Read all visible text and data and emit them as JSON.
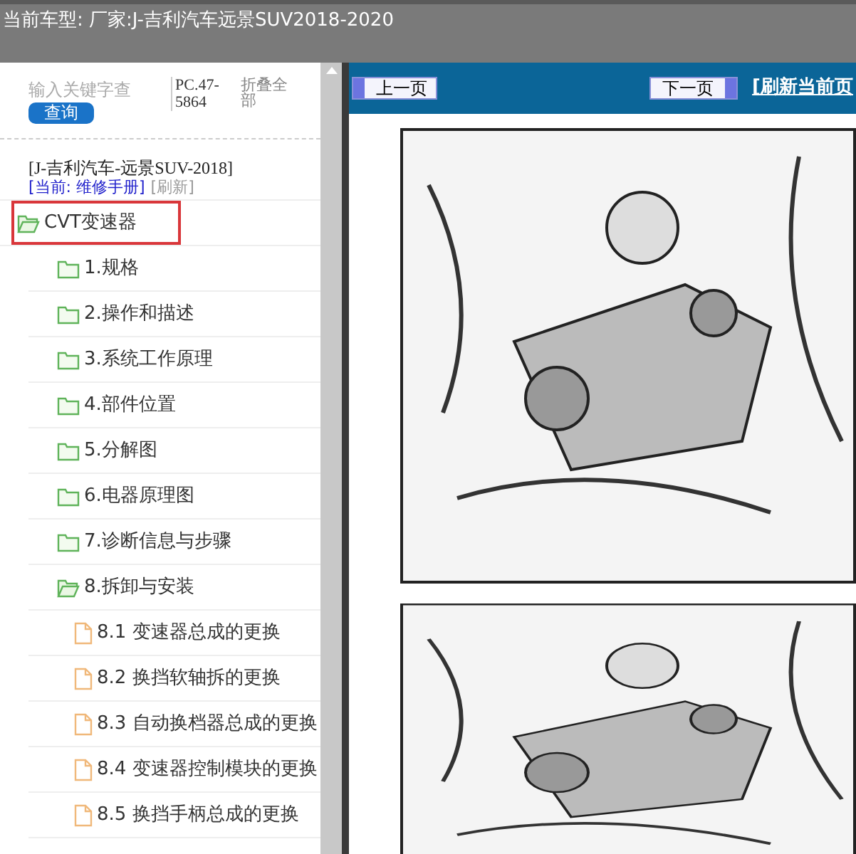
{
  "title_bar": {
    "text": "当前车型:  厂家:J-吉利汽车远景SUV2018-2020"
  },
  "sidebar": {
    "search": {
      "placeholder": "输入关键字查"
    },
    "search_button": "查询",
    "code": "PC.47-5864",
    "collapse_all": "折叠全部",
    "vehicle": "[J-吉利汽车-远景SUV-2018]",
    "current": "[当前: 维修手册]",
    "refresh": "[刷新]",
    "tree": [
      {
        "label": "CVT变速器",
        "kind": "folder",
        "expanded": true,
        "selected": true,
        "children": [
          {
            "label": "1.规格",
            "kind": "folder",
            "expanded": false,
            "selected": false
          },
          {
            "label": "2.操作和描述",
            "kind": "folder",
            "expanded": false,
            "selected": false
          },
          {
            "label": "3.系统工作原理",
            "kind": "folder",
            "expanded": false,
            "selected": false
          },
          {
            "label": "4.部件位置",
            "kind": "folder",
            "expanded": false,
            "selected": false
          },
          {
            "label": "5.分解图",
            "kind": "folder",
            "expanded": false,
            "selected": false
          },
          {
            "label": "6.电器原理图",
            "kind": "folder",
            "expanded": false,
            "selected": false
          },
          {
            "label": "7.诊断信息与步骤",
            "kind": "folder",
            "expanded": false,
            "selected": false
          },
          {
            "label": "8.拆卸与安装",
            "kind": "folder",
            "expanded": true,
            "selected": false,
            "children": [
              {
                "label": "8.1 变速器总成的更换",
                "kind": "file",
                "selected": false
              },
              {
                "label": "8.2 换挡软轴拆的更换",
                "kind": "file",
                "selected": false
              },
              {
                "label": "8.3 自动换档器总成的更换",
                "kind": "file",
                "selected": false
              },
              {
                "label": "8.4 变速器控制模块的更换",
                "kind": "file",
                "selected": false
              },
              {
                "label": "8.5 换挡手柄总成的更换",
                "kind": "file",
                "selected": false
              }
            ]
          }
        ]
      }
    ]
  },
  "viewer": {
    "prev_button": "上一页",
    "next_button": "下一页",
    "refresh_link": "[刷新当前页"
  }
}
